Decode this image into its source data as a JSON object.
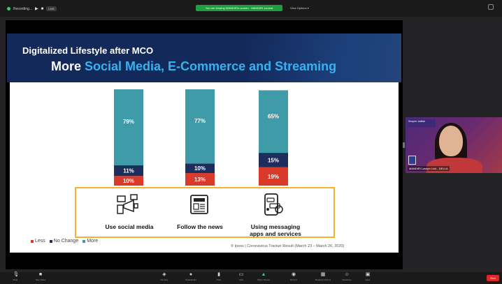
{
  "window": {
    "recording_label": "Recording...",
    "rec_controls": "LIVE",
    "share_banner": "You are viewing MANDIRI's screen  ·  MANDIRI Journal",
    "view_options": "View Options ▾"
  },
  "slide": {
    "title": "Digitalized Lifestyle after MCO",
    "subtitle_white": "More ",
    "subtitle_blue": "Social Media, E-Commerce and Streaming"
  },
  "chart_data": {
    "type": "bar",
    "stacked": true,
    "categories": [
      "Use social media",
      "Follow the news",
      "Using messaging apps and services"
    ],
    "series": [
      {
        "name": "Less",
        "color": "#d93a2a",
        "values": [
          10,
          13,
          19
        ]
      },
      {
        "name": "No Change",
        "color": "#1d2d5c",
        "values": [
          11,
          10,
          15
        ]
      },
      {
        "name": "More",
        "color": "#3f9ba8",
        "values": [
          79,
          77,
          65
        ]
      }
    ],
    "labels": [
      [
        "10%",
        "11%",
        "79%"
      ],
      [
        "13%",
        "10%",
        "77%"
      ],
      [
        "19%",
        "15%",
        "65%"
      ]
    ],
    "ylim": [
      0,
      100
    ]
  },
  "categories_text": {
    "cat1": "Use social media",
    "cat2": "Follow the news",
    "cat3_line1": "Using messaging",
    "cat3_line2": "apps and services"
  },
  "legend": {
    "less": "Less",
    "no_change": "No Change",
    "more": "More"
  },
  "source": "© Ipsos | Coronavirus Tracker Result (March 23 – March 26, 2020)",
  "participant": {
    "tag": "Shopee Jadilah",
    "name": "MANDIRI Lawyer Link - DELLA"
  },
  "toolbar": {
    "items": [
      "Mute",
      "Stop Video",
      "Security",
      "Participants",
      "Polls",
      "Chat",
      "Share Screen",
      "Record",
      "Breakout Rooms",
      "Reactions",
      "Apps"
    ],
    "participants_count": "73",
    "end_label": "End"
  }
}
